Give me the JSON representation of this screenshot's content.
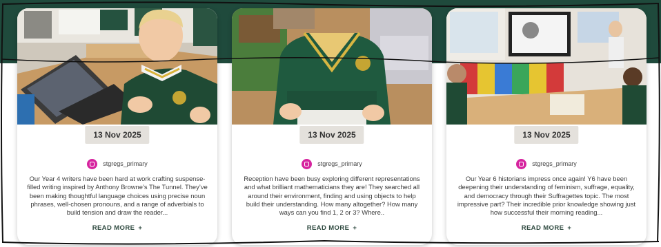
{
  "colors": {
    "band": "#1f4a3c",
    "instagram": "#d6249f",
    "date_badge_bg": "#e4e1dc",
    "read_more_text": "#2f4a40"
  },
  "posts": [
    {
      "date": "13 Nov 2025",
      "handle": "stgregs_primary",
      "caption": "Our Year 4 writers have been hard at work crafting suspense-filled writing inspired by Anthony Browne’s The Tunnel. They’ve been making thoughtful language choices using precise noun phrases, well-chosen pronouns, and a range of adverbials to build tension and draw the reader...",
      "read_more_label": "READ MORE",
      "plus_icon": "+",
      "icon": "instagram-icon"
    },
    {
      "date": "13 Nov 2025",
      "handle": "stgregs_primary",
      "caption": "Reception have been busy exploring different representations and what brilliant mathematicians they are! They searched all around their environment, finding and using objects to help build their understanding. How many altogether? How many ways can you find 1, 2 or 3? Where..",
      "read_more_label": "READ MORE",
      "plus_icon": "+",
      "icon": "instagram-icon"
    },
    {
      "date": "13 Nov 2025",
      "handle": "stgregs_primary",
      "caption": "Our Year 6 historians impress once again! Y6 have been deepening their understanding of feminism, suffrage, equality, and democracy through their Suffragettes topic. The most impressive part? Their incredible prior knowledge showing just how successful their morning reading...",
      "read_more_label": "READ MORE",
      "plus_icon": "+",
      "icon": "instagram-icon"
    }
  ]
}
